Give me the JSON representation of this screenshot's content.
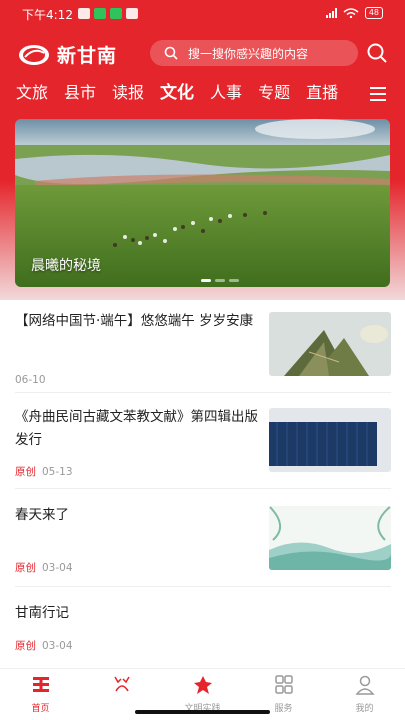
{
  "status": {
    "time": "下午4:12",
    "battery": "48"
  },
  "header": {
    "logo_text": "新甘南",
    "search_placeholder": "搜一搜你感兴趣的内容"
  },
  "tabs": [
    {
      "label": "文旅"
    },
    {
      "label": "县市"
    },
    {
      "label": "读报"
    },
    {
      "label": "文化",
      "active": true
    },
    {
      "label": "人事"
    },
    {
      "label": "专题"
    },
    {
      "label": "直播"
    }
  ],
  "banner": {
    "caption": "晨曦的秘境",
    "pages": 3,
    "current_page": 1
  },
  "news": [
    {
      "title": "【网络中国节·端午】悠悠端午 岁岁安康",
      "tag": "",
      "date": "06-10",
      "thumb": "zongzi"
    },
    {
      "title": "《舟曲民间古藏文苯教文献》第四辑出版发行",
      "tag": "原创",
      "date": "05-13",
      "thumb": "books"
    },
    {
      "title": "春天来了",
      "tag": "原创",
      "date": "03-04",
      "thumb": "spring"
    },
    {
      "title": "甘南行记",
      "tag": "原创",
      "date": "03-04",
      "thumb": ""
    }
  ],
  "bottom_nav": [
    {
      "label": "首页",
      "icon": "home-icon",
      "active": true
    },
    {
      "label": "",
      "icon": "deer-icon"
    },
    {
      "label": "文明实践",
      "icon": "civilization-icon"
    },
    {
      "label": "服务",
      "icon": "grid-icon"
    },
    {
      "label": "我的",
      "icon": "user-icon"
    }
  ],
  "colors": {
    "brand": "#e4252b",
    "meta": "#999999"
  }
}
